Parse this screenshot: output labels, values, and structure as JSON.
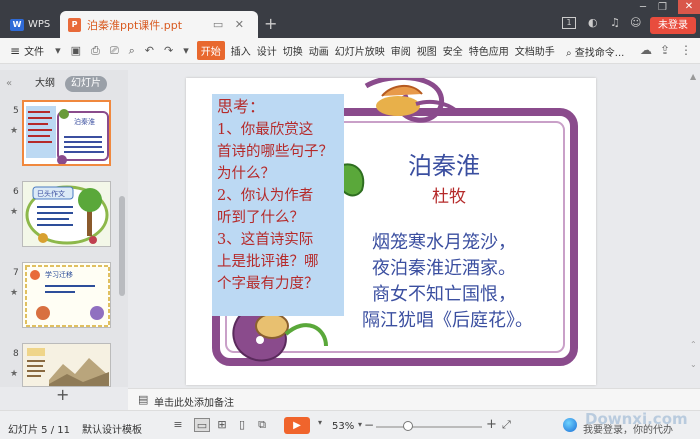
{
  "titlebar": {
    "app_label": "WPS",
    "doc_tab_title": "泊秦淮ppt课件.ppt",
    "new_tab_symbol": "+",
    "badge_number": "1",
    "login_label": "未登录",
    "close_symbol": "✕"
  },
  "menubar": {
    "file_label": "文件",
    "tabs": [
      "开始",
      "插入",
      "设计",
      "切换",
      "动画",
      "幻灯片放映",
      "审阅",
      "视图",
      "安全",
      "特色应用",
      "文档助手"
    ],
    "active_tab": "开始",
    "search_label": "查找命令..."
  },
  "leftpanel": {
    "outline_tab": "大纲",
    "slides_tab": "幻灯片",
    "collapse_symbol": "«",
    "thumbnails": [
      {
        "number": "5",
        "title": "泊秦淮",
        "selected": true
      },
      {
        "number": "6",
        "title": "巳头作文",
        "selected": false
      },
      {
        "number": "7",
        "title": "学习迁移",
        "selected": false
      },
      {
        "number": "8",
        "title": "",
        "selected": false
      }
    ],
    "add_symbol": "+"
  },
  "slide": {
    "think_title": "思考：",
    "think_lines": [
      "1、你最欣赏这",
      "首诗的哪些句子？",
      "为什么？",
      "2、你认为作者",
      "听到了什么？",
      "3、这首诗实际",
      "上是批评谁？哪",
      "个字最有力度？"
    ],
    "poem_title": "泊秦淮",
    "poem_author": "杜牧",
    "poem_lines": [
      "烟笼寒水月笼沙，",
      "夜泊秦淮近酒家。",
      "商女不知亡国恨，",
      "隔江犹唱《后庭花》。"
    ]
  },
  "notes": {
    "placeholder": "单击此处添加备注"
  },
  "statusbar": {
    "slide_count": "幻灯片 5 / 11",
    "template": "默认设计模板",
    "zoom": "53%",
    "zoom_level_percent": 30,
    "assistant_text": "我要登录，你的代办"
  },
  "watermark": "Downxi.com",
  "colors": {
    "accent": "#e8682e",
    "poem_blue": "#3b4fa0",
    "think_red": "#b52a2a",
    "frame_purple": "#8a4b8c",
    "think_bg": "#bcd9f3"
  }
}
